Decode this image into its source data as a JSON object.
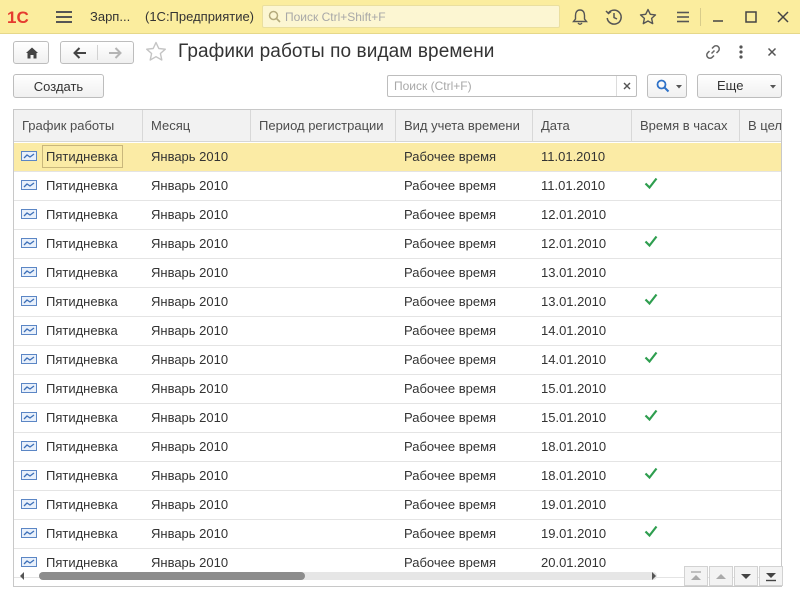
{
  "titlebar": {
    "logo": "1С",
    "app_name": "Зарп...",
    "base_name": "(1С:Предприятие)",
    "search_placeholder": "Поиск Ctrl+Shift+F",
    "icons": [
      "bell-icon",
      "history-icon",
      "star-icon",
      "menu-icon",
      "minimize-icon",
      "maximize-icon",
      "close-icon"
    ]
  },
  "form": {
    "title": "Графики работы по видам времени",
    "icons": [
      "link-icon",
      "more-vertical-icon",
      "close-icon"
    ]
  },
  "commandbar": {
    "create_label": "Создать",
    "search_placeholder": "Поиск (Ctrl+F)",
    "more_label": "Еще"
  },
  "table": {
    "columns": [
      "График работы",
      "Месяц",
      "Период регистрации",
      "Вид учета времени",
      "Дата",
      "Время в часах",
      "В целом"
    ],
    "rows": [
      {
        "schedule": "Пятидневка",
        "month": "Январь 2010",
        "period": "",
        "kind": "Рабочее время",
        "date": "11.01.2010",
        "hours": false,
        "selected": true
      },
      {
        "schedule": "Пятидневка",
        "month": "Январь 2010",
        "period": "",
        "kind": "Рабочее время",
        "date": "11.01.2010",
        "hours": true
      },
      {
        "schedule": "Пятидневка",
        "month": "Январь 2010",
        "period": "",
        "kind": "Рабочее время",
        "date": "12.01.2010",
        "hours": false
      },
      {
        "schedule": "Пятидневка",
        "month": "Январь 2010",
        "period": "",
        "kind": "Рабочее время",
        "date": "12.01.2010",
        "hours": true
      },
      {
        "schedule": "Пятидневка",
        "month": "Январь 2010",
        "period": "",
        "kind": "Рабочее время",
        "date": "13.01.2010",
        "hours": false
      },
      {
        "schedule": "Пятидневка",
        "month": "Январь 2010",
        "period": "",
        "kind": "Рабочее время",
        "date": "13.01.2010",
        "hours": true
      },
      {
        "schedule": "Пятидневка",
        "month": "Январь 2010",
        "period": "",
        "kind": "Рабочее время",
        "date": "14.01.2010",
        "hours": false
      },
      {
        "schedule": "Пятидневка",
        "month": "Январь 2010",
        "period": "",
        "kind": "Рабочее время",
        "date": "14.01.2010",
        "hours": true
      },
      {
        "schedule": "Пятидневка",
        "month": "Январь 2010",
        "period": "",
        "kind": "Рабочее время",
        "date": "15.01.2010",
        "hours": false
      },
      {
        "schedule": "Пятидневка",
        "month": "Январь 2010",
        "period": "",
        "kind": "Рабочее время",
        "date": "15.01.2010",
        "hours": true
      },
      {
        "schedule": "Пятидневка",
        "month": "Январь 2010",
        "period": "",
        "kind": "Рабочее время",
        "date": "18.01.2010",
        "hours": false
      },
      {
        "schedule": "Пятидневка",
        "month": "Январь 2010",
        "period": "",
        "kind": "Рабочее время",
        "date": "18.01.2010",
        "hours": true
      },
      {
        "schedule": "Пятидневка",
        "month": "Январь 2010",
        "period": "",
        "kind": "Рабочее время",
        "date": "19.01.2010",
        "hours": false
      },
      {
        "schedule": "Пятидневка",
        "month": "Январь 2010",
        "period": "",
        "kind": "Рабочее время",
        "date": "19.01.2010",
        "hours": true
      },
      {
        "schedule": "Пятидневка",
        "month": "Январь 2010",
        "period": "",
        "kind": "Рабочее время",
        "date": "20.01.2010",
        "hours": false
      }
    ],
    "row_icon": "record-icon",
    "check_icon": "checkmark-icon"
  },
  "scrollbar": {
    "horizontal_position": 0.43
  },
  "colors": {
    "titlebar_bg": "#fbed9e",
    "selected_row": "#fbeba5",
    "check_green": "#2e9e4f",
    "logo_red": "#e53b2f"
  }
}
